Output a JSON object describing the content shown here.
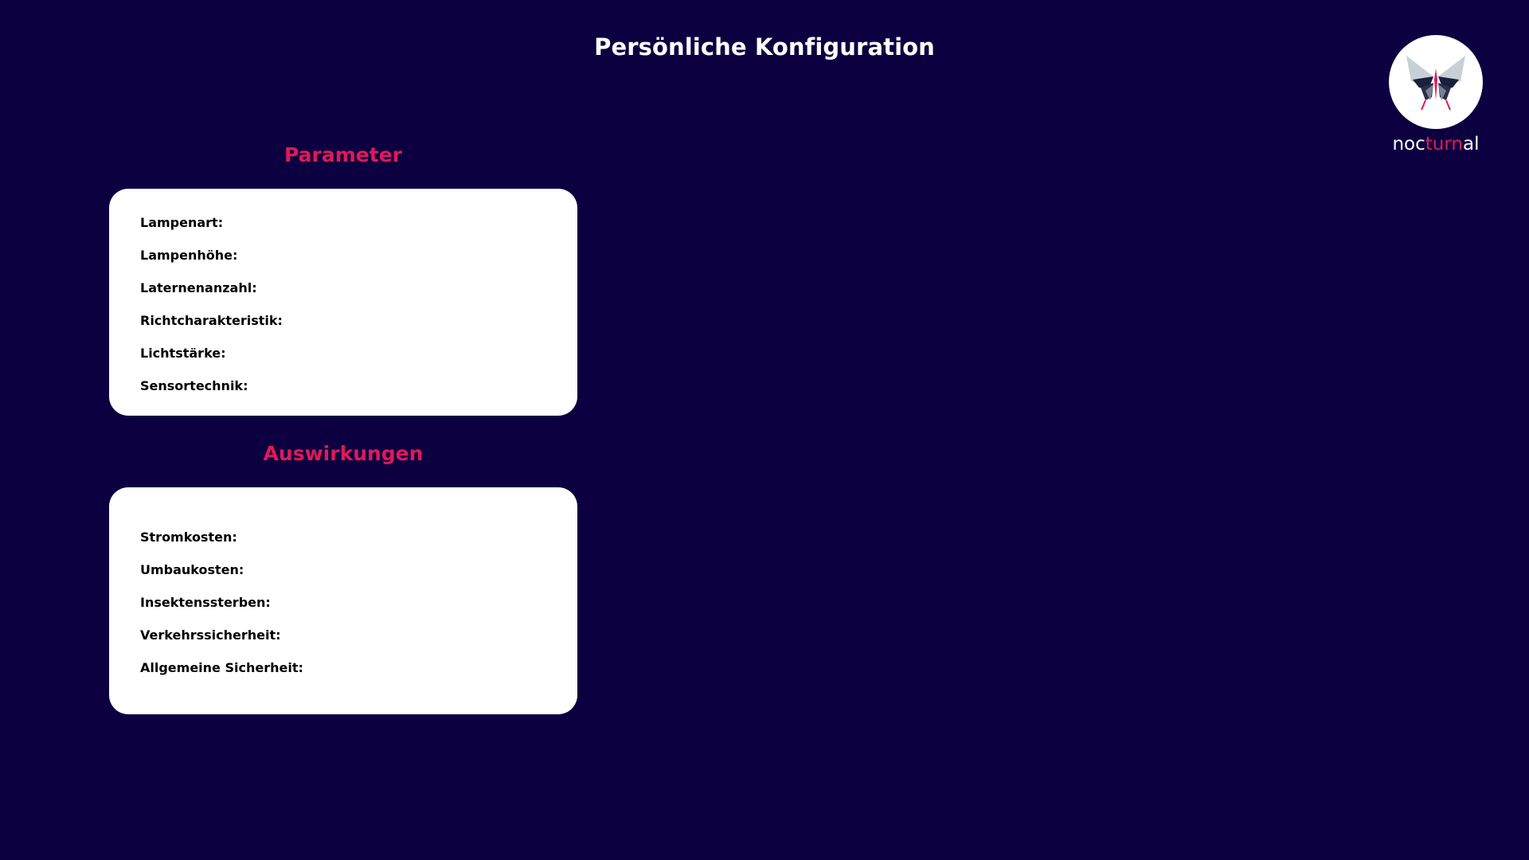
{
  "header": {
    "title": "Persönliche Konfiguration"
  },
  "logo": {
    "text_part1": "noc",
    "text_part2": "turn",
    "text_part3": "al",
    "icon": "butterfly-icon",
    "accent_color": "#e0185a"
  },
  "colors": {
    "background": "#0c0040",
    "accent": "#e0185a",
    "panel": "#ffffff"
  },
  "parameter": {
    "heading": "Parameter",
    "items": [
      {
        "label": "Lampenart:"
      },
      {
        "label": "Lampenhöhe:"
      },
      {
        "label": "Laternenanzahl:"
      },
      {
        "label": "Richtcharakteristik:"
      },
      {
        "label": "Lichtstärke:"
      },
      {
        "label": "Sensortechnik:"
      }
    ]
  },
  "auswirkungen": {
    "heading": "Auswirkungen",
    "items": [
      {
        "label": "Stromkosten:"
      },
      {
        "label": "Umbaukosten:"
      },
      {
        "label": "Insektenssterben:"
      },
      {
        "label": "Verkehrssicherheit:"
      },
      {
        "label": "Allgemeine Sicherheit:"
      }
    ]
  }
}
